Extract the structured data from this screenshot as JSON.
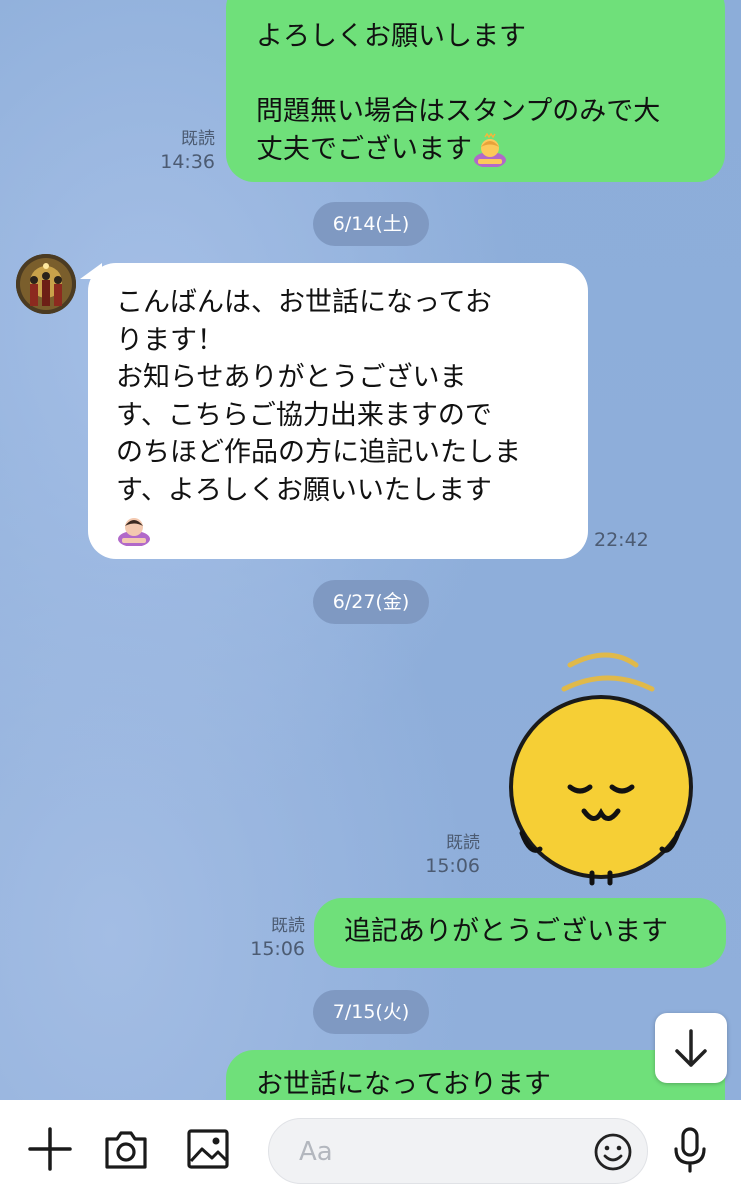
{
  "chat": {
    "messages": [
      {
        "id": "m1",
        "direction": "outgoing",
        "lines": [
          "よろしくお願いします",
          "",
          "問題無い場合はスタンプのみで大",
          "丈夫でございます"
        ],
        "emoji": "bowing-woman-emoji",
        "read_label": "既読",
        "time": "14:36"
      },
      {
        "id": "d1",
        "date": "6/14(土)"
      },
      {
        "id": "m2",
        "direction": "incoming",
        "lines": [
          "こんばんは、お世話になってお",
          "ります！",
          "お知らせありがとうございま",
          "す、こちらご協力出来ますので",
          "のちほど作品の方に追記いたしま",
          "す、よろしくお願いいたします"
        ],
        "emoji": "bowing-woman-emoji",
        "time": "22:42"
      },
      {
        "id": "d2",
        "date": "6/27(金)"
      },
      {
        "id": "m3",
        "direction": "outgoing",
        "sticker": "bowing-yellow-face-sticker",
        "read_label": "既読",
        "time": "15:06"
      },
      {
        "id": "m4",
        "direction": "outgoing",
        "lines": [
          "追記ありがとうございます"
        ],
        "read_label": "既読",
        "time": "15:06"
      },
      {
        "id": "d3",
        "date": "7/15(火)"
      },
      {
        "id": "m5",
        "direction": "outgoing",
        "lines": [
          "お世話になっております"
        ]
      }
    ]
  },
  "input_bar": {
    "placeholder": "Aa",
    "value": "",
    "icons": [
      "plus-icon",
      "camera-icon",
      "image-icon",
      "emoji-icon",
      "microphone-icon"
    ]
  },
  "scroll_button_icon": "arrow-down-icon",
  "colors": {
    "outgoing_bubble": "#6fe07a",
    "incoming_bubble": "#ffffff",
    "chat_background": "#8cabd9",
    "date_pill": "#7f99c2"
  }
}
